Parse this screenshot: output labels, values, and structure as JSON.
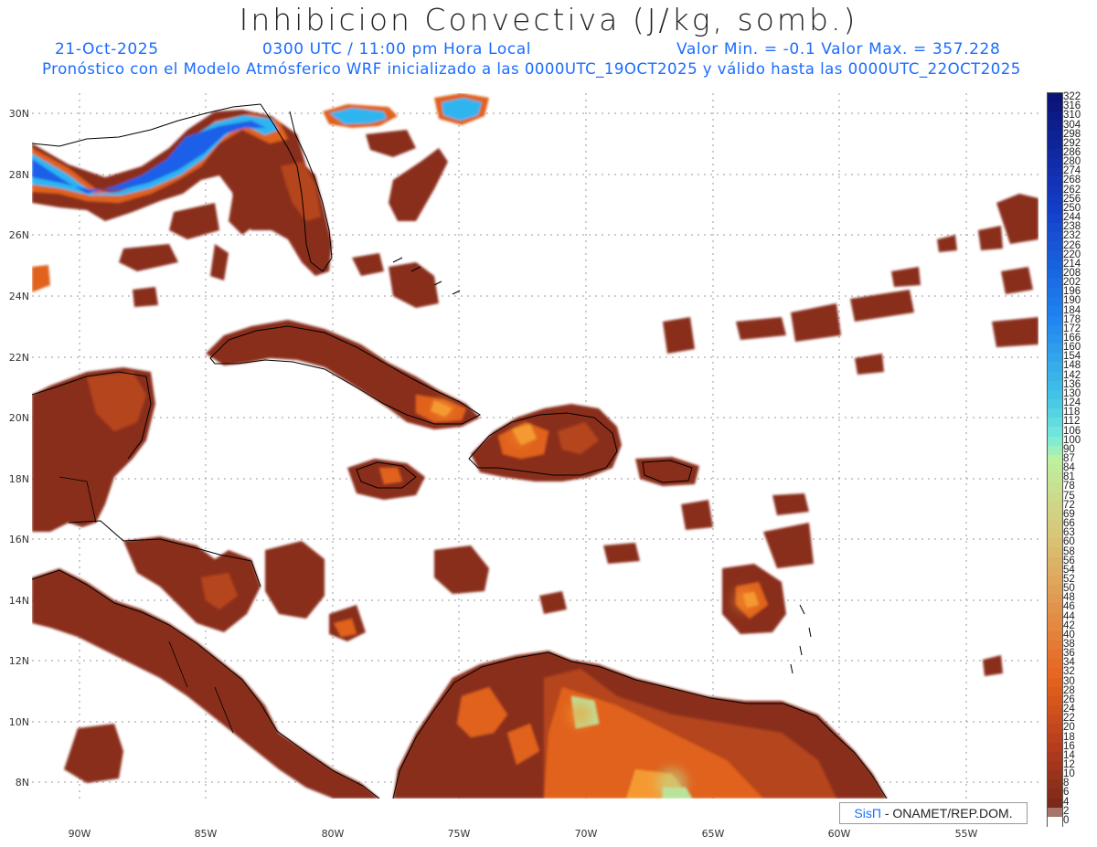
{
  "header": {
    "title": "Inhibicion Convectiva (J/kg, somb.)",
    "date": "21-Oct-2025",
    "time": "0300 UTC / 11:00 pm Hora Local",
    "minmax": "Valor Min. = -0.1  Valor Max. = 357.228",
    "model_info": "Pronóstico con el Modelo Atmósferico WRF inicializado a las 0000UTC_19OCT2025 y válido hasta las  0000UTC_22OCT2025"
  },
  "map": {
    "lat_labels": [
      "30N",
      "28N",
      "26N",
      "24N",
      "22N",
      "20N",
      "18N",
      "16N",
      "14N",
      "12N",
      "10N",
      "8N"
    ],
    "lon_labels": [
      "90W",
      "85W",
      "80W",
      "75W",
      "70W",
      "65W",
      "60W",
      "55W"
    ],
    "field_colors": {
      "low": "#8a2e1c",
      "mid": "#b5441d",
      "warm": "#e0621a",
      "hot": "#f59a33",
      "pale": "#b9e39a",
      "cyan": "#2fb5f0",
      "blue": "#1c5fe8"
    }
  },
  "colorbar": {
    "labels": [
      "322",
      "316",
      "310",
      "304",
      "298",
      "292",
      "286",
      "280",
      "274",
      "268",
      "262",
      "256",
      "250",
      "244",
      "238",
      "232",
      "226",
      "220",
      "214",
      "208",
      "202",
      "196",
      "190",
      "184",
      "178",
      "172",
      "166",
      "160",
      "154",
      "148",
      "142",
      "136",
      "130",
      "124",
      "118",
      "112",
      "106",
      "100",
      "90",
      "87",
      "84",
      "81",
      "78",
      "75",
      "72",
      "69",
      "66",
      "63",
      "60",
      "58",
      "56",
      "54",
      "52",
      "50",
      "48",
      "46",
      "44",
      "42",
      "40",
      "38",
      "36",
      "34",
      "32",
      "30",
      "28",
      "26",
      "24",
      "22",
      "20",
      "18",
      "16",
      "14",
      "12",
      "10",
      "8",
      "6",
      "4",
      "2",
      "0"
    ]
  },
  "credit": {
    "brand": "SisΠ",
    "org": " - ONAMET/REP.DOM."
  }
}
